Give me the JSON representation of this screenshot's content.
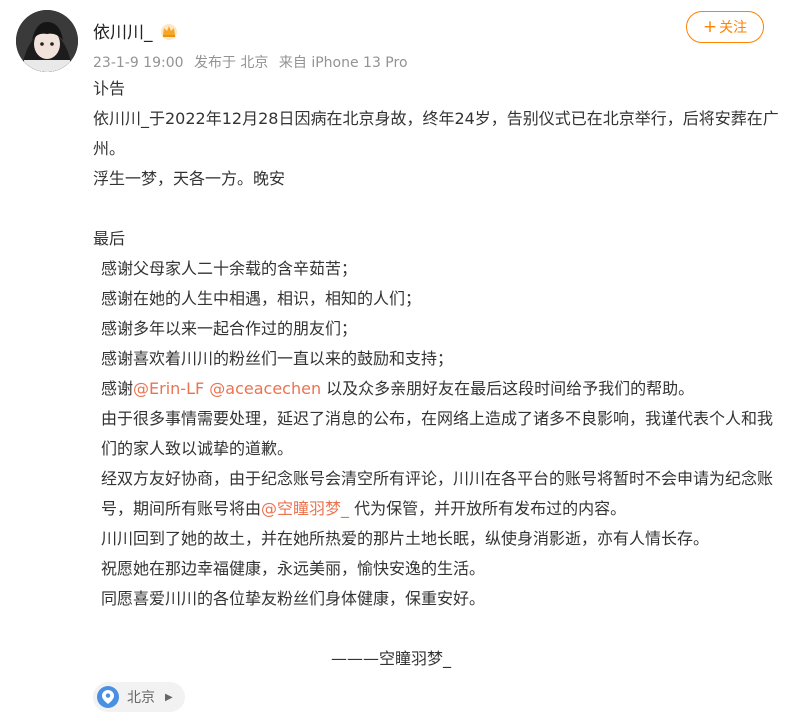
{
  "post": {
    "username": "依川川_",
    "date": "23-1-9 19:00",
    "posted_from": "发布于 北京",
    "device": "来自 iPhone 13 Pro",
    "follow_label": "关注"
  },
  "content": {
    "title": "讣告",
    "p1": "依川川_于2022年12月28日因病在北京身故，终年24岁，告别仪式已在北京举行，后将安葬在广州。",
    "p2": "浮生一梦，天各一方。晚安",
    "last_heading": "最后",
    "thanks": [
      "感谢父母家人二十余载的含辛茹苦；",
      "感谢在她的人生中相遇，相识，相知的人们；",
      "感谢多年以来一起合作过的朋友们；",
      "感谢喜欢着川川的粉丝们一直以来的鼓励和支持；"
    ],
    "thanks5_prefix": "感谢",
    "mention1": "@Erin-LF",
    "mention2": "@aceacechen",
    "thanks5_suffix": " 以及众多亲朋好友在最后这段时间给予我们的帮助。",
    "apology": "由于很多事情需要处理，延迟了消息的公布，在网络上造成了诸多不良影响，我谨代表个人和我们的家人致以诚挚的道歉。",
    "account_prefix": "经双方友好协商，由于纪念账号会清空所有评论，川川在各平台的账号将暂时不会申请为纪念账号，期间所有账号将由",
    "mention3": "@空瞳羽梦_",
    "account_suffix": " 代为保管，并开放所有发布过的内容。",
    "closing": [
      "川川回到了她的故土，并在她所热爱的那片土地长眠，纵使身消影逝，亦有人情长存。",
      "祝愿她在那边幸福健康，永远美丽，愉快安逸的生活。",
      "同愿喜爱川川的各位挚友粉丝们身体健康，保重安好。"
    ],
    "signature": "———空瞳羽梦_"
  },
  "location": {
    "label": "北京"
  },
  "colors": {
    "accent": "#ff8200",
    "mention": "#eb7350",
    "meta": "#939393"
  }
}
